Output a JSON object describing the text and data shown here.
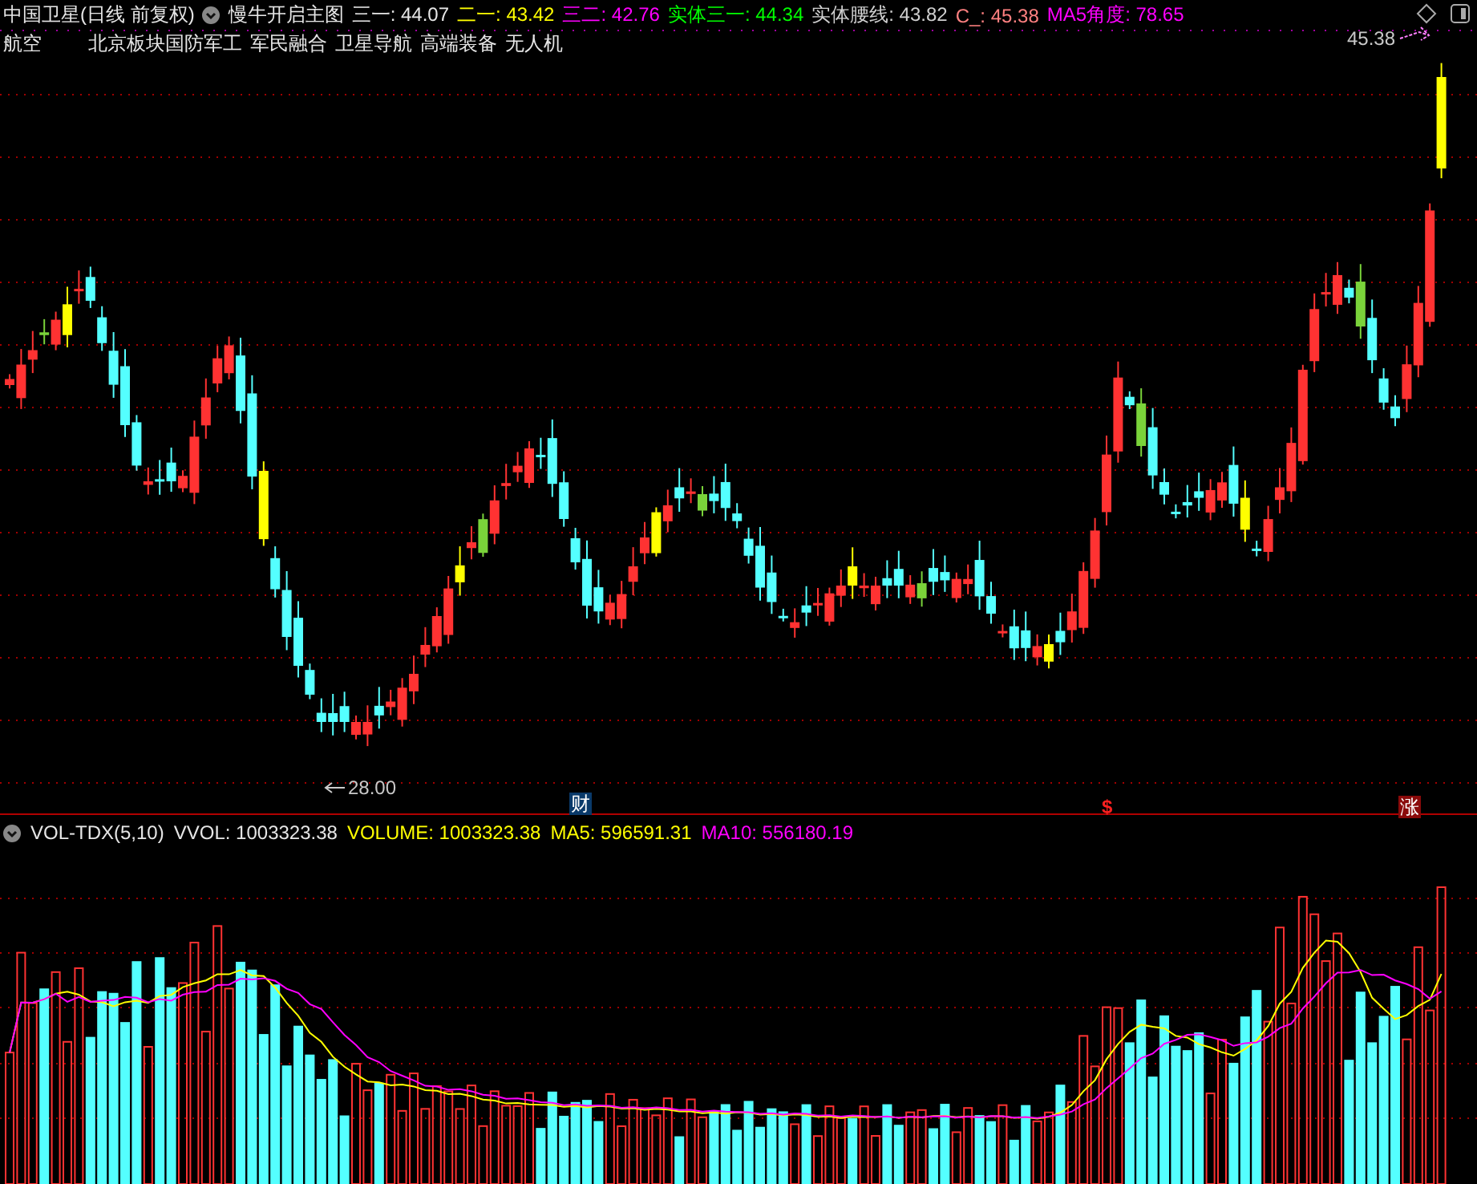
{
  "header": {
    "stock": "中国卫星(日线 前复权)",
    "indicator": "慢牛开启主图",
    "readings": [
      {
        "label": "三一:",
        "value": "44.07",
        "color": "#e6e6e6"
      },
      {
        "label": "二一:",
        "value": "43.42",
        "color": "#ffff00"
      },
      {
        "label": "三二:",
        "value": "42.76",
        "color": "#ff00ff"
      },
      {
        "label": "实体三一:",
        "value": "44.34",
        "color": "#00ff00"
      },
      {
        "label": "实体腰线:",
        "value": "43.82",
        "color": "#d0d0d0"
      },
      {
        "label": "C_:",
        "value": "45.38",
        "color": "#ff8080"
      },
      {
        "label": "MA5角度:",
        "value": "78.65",
        "color": "#ff00ff"
      }
    ]
  },
  "concepts": [
    "航空",
    "北京板块国防军工",
    "军民融合",
    "卫星导航",
    "高端装备",
    "无人机"
  ],
  "price_chart": {
    "high_label": "45.38",
    "low_label": "28.00",
    "markers": [
      {
        "text": "财",
        "kind": "finance"
      },
      {
        "text": "$",
        "kind": "dollar"
      },
      {
        "text": "涨",
        "kind": "rise"
      }
    ]
  },
  "volume_panel": {
    "name": "VOL-TDX(5,10)",
    "readings": [
      {
        "label": "VVOL:",
        "value": "1003323.38",
        "color": "#e6e6e6"
      },
      {
        "label": "VOLUME:",
        "value": "1003323.38",
        "color": "#ffff00"
      },
      {
        "label": "MA5:",
        "value": "596591.31",
        "color": "#ffff00"
      },
      {
        "label": "MA10:",
        "value": "556180.19",
        "color": "#ff00ff"
      }
    ]
  }
}
